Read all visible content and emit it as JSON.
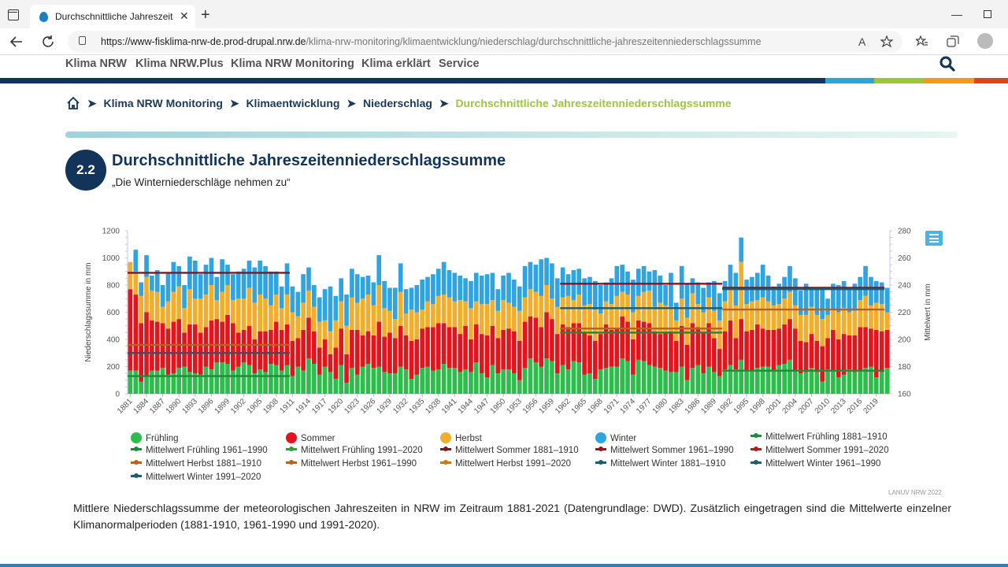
{
  "browser": {
    "tab_title": "Durchschnittliche Jahreszeitenniederschlagssumme",
    "new_tab": "+",
    "close": "✕",
    "url_host": "https://www-fisklima-nrw-de.prod-drupal.nrw.de",
    "url_path": "/klima-nrw-monitoring/klimaentwicklung/niederschlag/durchschnittliche-jahreszeitenniederschlagssumme",
    "read_aloud": "A",
    "min": "—"
  },
  "site_nav": {
    "items": [
      "Klima NRW",
      "Klima NRW.Plus",
      "Klima NRW Monitoring",
      "Klima erklärt",
      "Service"
    ]
  },
  "breadcrumb": {
    "items": [
      "Klima NRW Monitoring",
      "Klimaentwicklung",
      "Niederschlag"
    ],
    "current": "Durchschnittliche Jahreszeitenniederschlagssumme",
    "separator": "➤"
  },
  "section": {
    "number": "2.2",
    "title": "Durchschnittliche Jahreszeitenniederschlagssumme",
    "subtitle": "„Die Winterniederschläge nehmen zu“"
  },
  "colors": {
    "fruehling": "#2ebd4d",
    "sommer": "#e3141c",
    "herbst": "#f2ad2b",
    "winter": "#2ea4e2",
    "mean_fr": "#1f8a3a",
    "mean_so": "#8c1020",
    "mean_he": "#b8621f",
    "mean_wi": "#1d5c73"
  },
  "chart_data": {
    "type": "bar",
    "stacked": true,
    "x_start": 1881,
    "x_end": 2021,
    "ylabel": "Niederschlagssumme in mm",
    "ylabel_right": "Mittelwert in mm",
    "ylim": [
      0,
      1200
    ],
    "ylim_right": [
      160,
      280
    ],
    "yticks": [
      0,
      200,
      400,
      600,
      800,
      1000,
      1200
    ],
    "yticks_right": [
      160,
      180,
      200,
      220,
      240,
      260,
      280
    ],
    "xtick_labels": [
      "1881",
      "1884",
      "1887",
      "1890",
      "1893",
      "1896",
      "1899",
      "1902",
      "1905",
      "1908",
      "1911",
      "1914",
      "1917",
      "1920",
      "1923",
      "1926",
      "1929",
      "1932",
      "1935",
      "1938",
      "1941",
      "1944",
      "1947",
      "1950",
      "1953",
      "1956",
      "1959",
      "1962",
      "1965",
      "1968",
      "1971",
      "1974",
      "1977",
      "1980",
      "1983",
      "1986",
      "1989",
      "1992",
      "1995",
      "1998",
      "2001",
      "2004",
      "2007",
      "2010",
      "2013",
      "2016",
      "2019"
    ],
    "series_order": [
      "Frühling",
      "Sommer",
      "Herbst",
      "Winter"
    ],
    "totals_fruehling": [
      170,
      170,
      90,
      130,
      170,
      170,
      190,
      140,
      150,
      190,
      200,
      160,
      150,
      140,
      200,
      180,
      230,
      230,
      220,
      170,
      200,
      230,
      210,
      150,
      180,
      160,
      220,
      210,
      170,
      210,
      130,
      200,
      170,
      260,
      220,
      140,
      200,
      160,
      110,
      210,
      80,
      190,
      140,
      200,
      220,
      190,
      200,
      160,
      150,
      150,
      200,
      180,
      110,
      140,
      190,
      200,
      170,
      180,
      220,
      190,
      190,
      160,
      180,
      160,
      230,
      150,
      120,
      210,
      150,
      180,
      180,
      150,
      100,
      190,
      260,
      230,
      200,
      260,
      240,
      150,
      210,
      180,
      240,
      230,
      140,
      150,
      110,
      180,
      190,
      200,
      200,
      260,
      240,
      140,
      250,
      240,
      210,
      200,
      190,
      170,
      160,
      160,
      200,
      100,
      190,
      210,
      150,
      200,
      160,
      130,
      180,
      210,
      180,
      250,
      170,
      170,
      190,
      200,
      200,
      170,
      210,
      220,
      250,
      170,
      150,
      160,
      190,
      160,
      90,
      180,
      170,
      120,
      140,
      180,
      160,
      170,
      190,
      200,
      120,
      160,
      190
    ],
    "totals_sommer": [
      600,
      560,
      430,
      470,
      370,
      360,
      330,
      340,
      380,
      360,
      250,
      350,
      360,
      310,
      290,
      360,
      320,
      300,
      360,
      350,
      250,
      240,
      290,
      250,
      280,
      300,
      250,
      320,
      300,
      300,
      260,
      210,
      300,
      300,
      240,
      200,
      200,
      130,
      230,
      270,
      210,
      280,
      330,
      230,
      240,
      240,
      330,
      260,
      300,
      260,
      300,
      250,
      280,
      260,
      290,
      290,
      320,
      340,
      300,
      300,
      300,
      280,
      320,
      240,
      280,
      290,
      310,
      290,
      260,
      290,
      300,
      310,
      290,
      340,
      310,
      330,
      290,
      340,
      310,
      290,
      300,
      310,
      280,
      290,
      310,
      280,
      280,
      260,
      320,
      270,
      280,
      310,
      290,
      260,
      290,
      290,
      310,
      260,
      250,
      280,
      300,
      230,
      300,
      260,
      330,
      280,
      300,
      320,
      250,
      200,
      280,
      330,
      230,
      300,
      290,
      300,
      320,
      280,
      270,
      300,
      270,
      290,
      300,
      310,
      240,
      220,
      250,
      230,
      260,
      230,
      300,
      280,
      300,
      250,
      270,
      320,
      300,
      280,
      350,
      300,
      280
    ],
    "totals_herbst": [
      200,
      170,
      200,
      260,
      220,
      220,
      120,
      200,
      220,
      240,
      180,
      260,
      190,
      250,
      240,
      260,
      140,
      220,
      220,
      170,
      250,
      230,
      280,
      270,
      270,
      240,
      180,
      200,
      160,
      220,
      210,
      160,
      200,
      200,
      180,
      190,
      140,
      170,
      200,
      200,
      210,
      240,
      200,
      270,
      270,
      220,
      270,
      210,
      160,
      140,
      250,
      160,
      230,
      200,
      140,
      190,
      170,
      200,
      210,
      220,
      190,
      250,
      180,
      230,
      170,
      220,
      230,
      190,
      200,
      220,
      190,
      180,
      220,
      180,
      200,
      190,
      230,
      200,
      150,
      200,
      200,
      230,
      170,
      210,
      200,
      230,
      230,
      150,
      170,
      190,
      240,
      180,
      200,
      200,
      180,
      220,
      240,
      180,
      230,
      200,
      180,
      150,
      200,
      200,
      220,
      170,
      150,
      190,
      200,
      210,
      220,
      240,
      240,
      420,
      200,
      210,
      180,
      230,
      210,
      180,
      180,
      190,
      200,
      170,
      190,
      200,
      200,
      190,
      200,
      170,
      150,
      200,
      190,
      170,
      180,
      200,
      230,
      170,
      200,
      200,
      130
    ],
    "totals_winter": [
      0,
      160,
      100,
      160,
      110,
      160,
      160,
      210,
      220,
      150,
      170,
      240,
      280,
      180,
      220,
      200,
      170,
      240,
      150,
      190,
      200,
      220,
      200,
      260,
      250,
      240,
      250,
      170,
      160,
      230,
      190,
      180,
      210,
      170,
      160,
      180,
      230,
      330,
      180,
      170,
      230,
      210,
      210,
      160,
      140,
      170,
      220,
      200,
      170,
      230,
      210,
      180,
      160,
      200,
      220,
      180,
      220,
      200,
      240,
      200,
      210,
      180,
      170,
      200,
      210,
      210,
      220,
      200,
      160,
      180,
      220,
      200,
      180,
      230,
      200,
      200,
      270,
      200,
      260,
      210,
      220,
      160,
      220,
      190,
      200,
      200,
      210,
      210,
      140,
      190,
      220,
      200,
      170,
      240,
      200,
      190,
      140,
      270,
      200,
      150,
      250,
      130,
      240,
      250,
      110,
      160,
      180,
      110,
      220,
      200,
      150,
      170,
      240,
      180,
      180,
      180,
      200,
      240,
      190,
      140,
      150,
      160,
      190,
      200,
      180,
      230,
      140,
      200,
      220,
      120,
      190,
      200,
      200,
      180,
      200,
      170,
      220,
      210,
      160,
      160,
      180
    ],
    "means": [
      {
        "name": "Mittelwert Frühling 1881–1910",
        "period": [
          1881,
          1910
        ],
        "value": 173,
        "axis": "right"
      },
      {
        "name": "Mittelwert Frühling 1961–1990",
        "period": [
          1961,
          1990
        ],
        "value": 205,
        "axis": "right"
      },
      {
        "name": "Mittelwert Frühling 1991–2020",
        "period": [
          1991,
          2020
        ],
        "value": 177,
        "axis": "right"
      },
      {
        "name": "Mittelwert Sommer 1881–1910",
        "period": [
          1881,
          1910
        ],
        "value": 249,
        "axis": "right"
      },
      {
        "name": "Mittelwert Sommer 1961–1990",
        "period": [
          1961,
          1990
        ],
        "value": 241,
        "axis": "right"
      },
      {
        "name": "Mittelwert Sommer 1991–2020",
        "period": [
          1991,
          2020
        ],
        "value": 238,
        "axis": "right"
      },
      {
        "name": "Mittelwert Herbst 1881–1910",
        "period": [
          1881,
          1910
        ],
        "value": 196,
        "axis": "right"
      },
      {
        "name": "Mittelwert Herbst 1961–1990",
        "period": [
          1961,
          1990
        ],
        "value": 208,
        "axis": "right"
      },
      {
        "name": "Mittelwert Herbst 1991–2020",
        "period": [
          1991,
          2020
        ],
        "value": 222,
        "axis": "right"
      },
      {
        "name": "Mittelwert Winter 1881–1910",
        "period": [
          1881,
          1910
        ],
        "value": 190,
        "axis": "right"
      },
      {
        "name": "Mittelwert Winter 1961–1990",
        "period": [
          1961,
          1990
        ],
        "value": 223,
        "axis": "right"
      },
      {
        "name": "Mittelwert Winter 1991–2020",
        "period": [
          1991,
          2020
        ],
        "value": 237,
        "axis": "right"
      }
    ],
    "legend": [
      {
        "label": "Frühling",
        "kind": "dot",
        "color": "#2ebd4d"
      },
      {
        "label": "Sommer",
        "kind": "dot",
        "color": "#e3141c"
      },
      {
        "label": "Herbst",
        "kind": "dot",
        "color": "#f2ad2b"
      },
      {
        "label": "Winter",
        "kind": "dot",
        "color": "#2ea4e2"
      },
      {
        "label": "Mittelwert Frühling 1881–1910",
        "kind": "line",
        "color": "#1f8a3a"
      },
      {
        "label": "Mittelwert Frühling 1961–1990",
        "kind": "line",
        "color": "#1f8a3a"
      },
      {
        "label": "Mittelwert Frühling 1991–2020",
        "kind": "line",
        "color": "#2f9e3f"
      },
      {
        "label": "Mittelwert Sommer 1881–1910",
        "kind": "line",
        "color": "#8c1020"
      },
      {
        "label": "Mittelwert Sommer 1961–1990",
        "kind": "line",
        "color": "#a0101c"
      },
      {
        "label": "Mittelwert Sommer 1991–2020",
        "kind": "line",
        "color": "#c0141c"
      },
      {
        "label": "Mittelwert Herbst 1881–1910",
        "kind": "line",
        "color": "#b8621f"
      },
      {
        "label": "Mittelwert Herbst 1961–1990",
        "kind": "line",
        "color": "#b8621f"
      },
      {
        "label": "Mittelwert Herbst 1991–2020",
        "kind": "line",
        "color": "#c77a1a"
      },
      {
        "label": "Mittelwert Winter 1881–1910",
        "kind": "line",
        "color": "#1d5c73"
      },
      {
        "label": "Mittelwert Winter 1961–1990",
        "kind": "line",
        "color": "#1d5c73"
      },
      {
        "label": "Mittelwert Winter 1991–2020",
        "kind": "line",
        "color": "#1d5c73"
      }
    ]
  },
  "credit": "LANUV NRW 2022",
  "caption": "Mittlere Niederschlagssumme der meteorologischen Jahreszeiten in NRW im Zeitraum 1881-2021 (Datengrundlage: DWD). Zusätzlich eingetragen sind die Mittelwerte einzelner Klimanormalperioden (1881-1910, 1961-1990 und 1991-2020)."
}
